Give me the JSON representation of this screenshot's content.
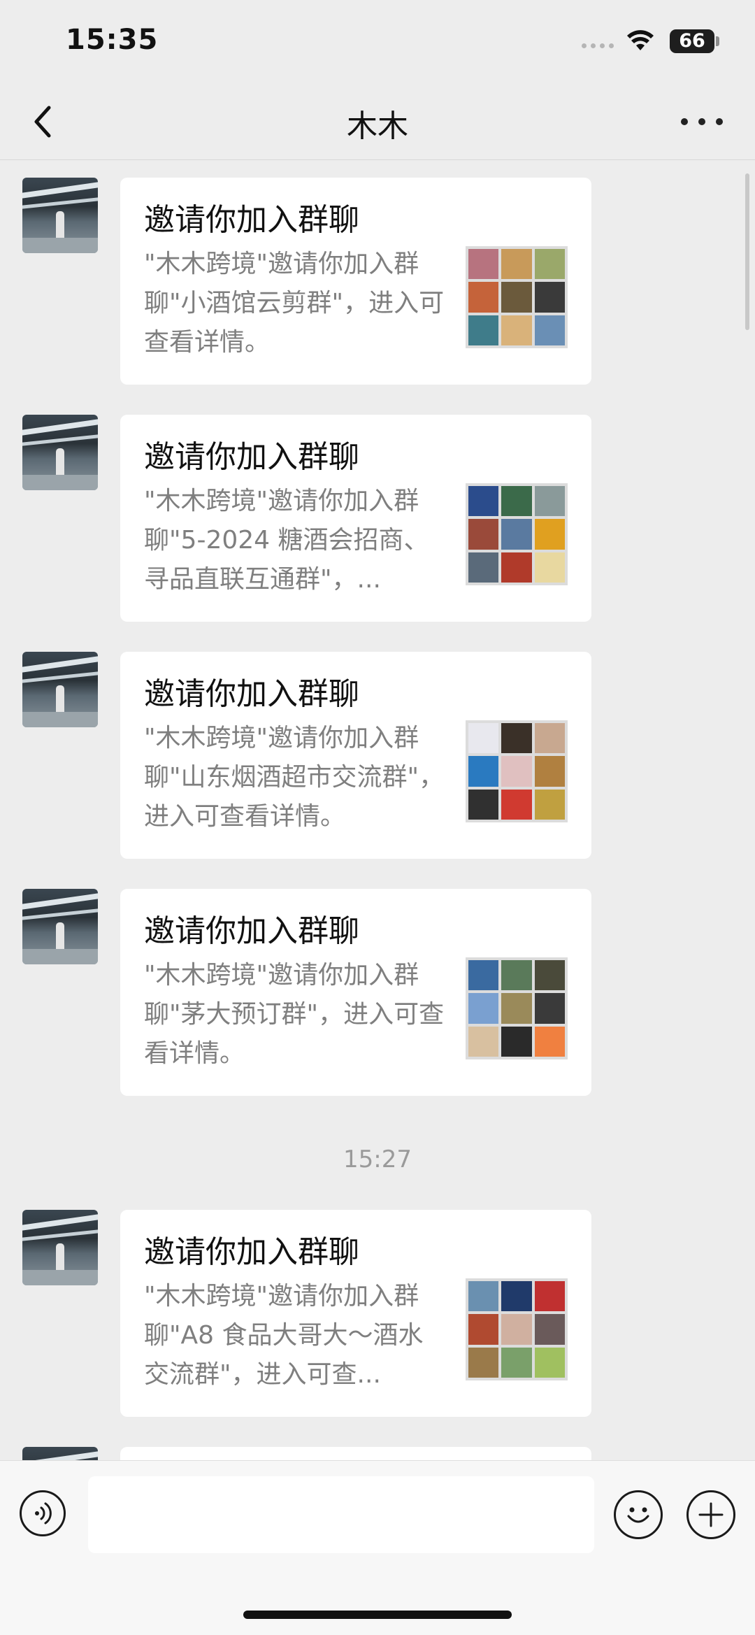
{
  "status_bar": {
    "time": "15:35",
    "battery": "66"
  },
  "header": {
    "title": "木木"
  },
  "messages": [
    {
      "title": "邀请你加入群聊",
      "description": "\"木木跨境\"邀请你加入群聊\"小酒馆云剪群\"，进入可查看详情。",
      "thumb_colors": [
        "#b7737f",
        "#c89a5a",
        "#9aa86a",
        "#c5633a",
        "#6b5a3c",
        "#3a3a3a",
        "#3f7c8a",
        "#d9b27a",
        "#6a8fb5"
      ]
    },
    {
      "title": "邀请你加入群聊",
      "description": "\"木木跨境\"邀请你加入群聊\"5-2024 糖酒会招商、寻品直联互通群\"，...",
      "thumb_colors": [
        "#2b4c8c",
        "#3b6a4a",
        "#8a9a9a",
        "#9a4a3a",
        "#5a7aa0",
        "#e0a020",
        "#5a6a7a",
        "#b03a2a",
        "#e8d8a0"
      ]
    },
    {
      "title": "邀请你加入群聊",
      "description": "\"木木跨境\"邀请你加入群聊\"山东烟酒超市交流群\"，进入可查看详情。",
      "thumb_colors": [
        "#e8e8ee",
        "#3a3028",
        "#c8a890",
        "#2a7ac0",
        "#e0c0c0",
        "#b08040",
        "#303030",
        "#d03a30",
        "#c0a040"
      ]
    },
    {
      "title": "邀请你加入群聊",
      "description": "\"木木跨境\"邀请你加入群聊\"茅大预订群\"，进入可查看详情。",
      "thumb_colors": [
        "#3a6aa0",
        "#5a7a5a",
        "#4a4a3a",
        "#7aa0d0",
        "#9a8a5a",
        "#3a3a3a",
        "#d8c0a0",
        "#2a2a2a",
        "#f08040"
      ]
    },
    {
      "title": "邀请你加入群聊",
      "description": "\"木木跨境\"邀请你加入群聊\"A8 食品大哥大～酒水交流群\"，进入可查...",
      "thumb_colors": [
        "#6a90b0",
        "#203a6a",
        "#c03030",
        "#b04a30",
        "#d0b0a0",
        "#6a5a5a",
        "#9a7a4a",
        "#7aa06a",
        "#a0c060"
      ]
    }
  ],
  "timestamp": "15:27",
  "input": {
    "placeholder": ""
  }
}
